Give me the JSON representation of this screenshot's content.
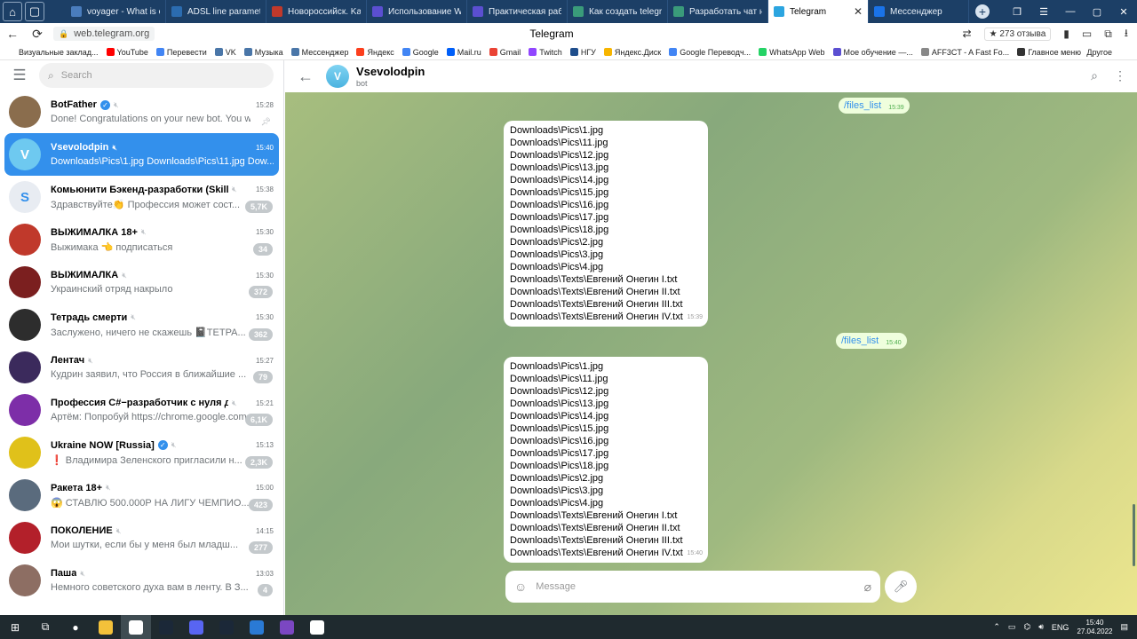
{
  "browser": {
    "tabs": [
      {
        "label": "voyager - What is co",
        "color": "#4a7dbd"
      },
      {
        "label": "ADSL line parameters",
        "color": "#2b6cb0"
      },
      {
        "label": "Новороссийск. Karat",
        "color": "#c0392b"
      },
      {
        "label": "Использование Web",
        "color": "#5b4fd1"
      },
      {
        "label": "Практическая работ",
        "color": "#5b4fd1"
      },
      {
        "label": "Как создать telegram",
        "color": "#3a9b7a"
      },
      {
        "label": "Разработать чат на C",
        "color": "#3a9b7a"
      },
      {
        "label": "Telegram",
        "color": "#2ca5e0",
        "active": true
      },
      {
        "label": "Мессенджер",
        "color": "#1a73e8"
      }
    ],
    "url": "web.telegram.org",
    "page_title": "Telegram",
    "rating_text": "★ 273 отзыва",
    "bookmarks": [
      {
        "label": "Визуальные заклад...",
        "color": "#ffffff"
      },
      {
        "label": "YouTube",
        "color": "#ff0000"
      },
      {
        "label": "Перевести",
        "color": "#4285f4"
      },
      {
        "label": "VK",
        "color": "#4a76a8"
      },
      {
        "label": "Музыка",
        "color": "#4a76a8"
      },
      {
        "label": "Мессенджер",
        "color": "#4a76a8"
      },
      {
        "label": "Яндекс",
        "color": "#fc3f1d"
      },
      {
        "label": "Google",
        "color": "#4285f4"
      },
      {
        "label": "Mail.ru",
        "color": "#005ff9"
      },
      {
        "label": "Gmail",
        "color": "#ea4335"
      },
      {
        "label": "Twitch",
        "color": "#9146ff"
      },
      {
        "label": "НГУ",
        "color": "#1f4e8c"
      },
      {
        "label": "Яндекс.Диск",
        "color": "#f7b500"
      },
      {
        "label": "Google Переводч...",
        "color": "#4285f4"
      },
      {
        "label": "WhatsApp Web",
        "color": "#25d366"
      },
      {
        "label": "Мое обучение —...",
        "color": "#5b4fd1"
      },
      {
        "label": "AFF3CT - A Fast Fo...",
        "color": "#888888"
      },
      {
        "label": "Главное меню",
        "color": "#333333"
      }
    ],
    "other_bookmarks": "Другое"
  },
  "sidebar": {
    "search_placeholder": "Search",
    "chats": [
      {
        "name": "BotFather",
        "time": "15:28",
        "preview": "Done! Congratulations on your new bot. You will ...",
        "badge": "",
        "pinned": true,
        "verified": true,
        "muted": true,
        "avatar_color": "#8a6d4d",
        "avatar_text": ""
      },
      {
        "name": "Vsevolodpin",
        "time": "15:40",
        "preview": "Downloads\\Pics\\1.jpg Downloads\\Pics\\11.jpg Dow...",
        "badge": "",
        "active": true,
        "muted": true,
        "avatar_color": "#6ec9f0",
        "avatar_text": "V"
      },
      {
        "name": "Комьюнити Бэкенд-разработки (Skillb...",
        "time": "15:38",
        "preview": "Здравствуйте👏 Профессия может сост...",
        "badge": "5,7K",
        "muted": true,
        "avatar_color": "#e8ecf2",
        "avatar_text": "S"
      },
      {
        "name": "ВЫЖИМАЛКА 18+",
        "time": "15:30",
        "preview": "Выжимака 👈 подписаться",
        "badge": "34",
        "muted": true,
        "avatar_color": "#c0392b",
        "avatar_text": ""
      },
      {
        "name": "ВЫЖИМАЛКА",
        "time": "15:30",
        "preview": "Украинский отряд накрыло",
        "badge": "372",
        "muted": true,
        "avatar_color": "#7b1f1f",
        "avatar_text": ""
      },
      {
        "name": "Тетрадь смерти",
        "time": "15:30",
        "preview": "Заслужено, ничего не скажешь 📓ТЕТРА...",
        "badge": "362",
        "muted": true,
        "avatar_color": "#2d2d2d",
        "avatar_text": ""
      },
      {
        "name": "Лентач",
        "time": "15:27",
        "preview": "Кудрин заявил, что Россия в ближайшие ...",
        "badge": "79",
        "muted": true,
        "avatar_color": "#3b2a5c",
        "avatar_text": ""
      },
      {
        "name": "Профессия C#−разработчик с нуля до ...",
        "time": "15:21",
        "preview": "Артём: Попробуй https://chrome.google.com...",
        "badge": "6,1K",
        "muted": true,
        "avatar_color": "#7d2ea8",
        "avatar_text": ""
      },
      {
        "name": "Ukraine NOW [Russia]",
        "time": "15:13",
        "preview": "❗ Владимира Зеленского пригласили н...",
        "badge": "2,3K",
        "verified": true,
        "muted": true,
        "avatar_color": "#e0c11a",
        "avatar_text": ""
      },
      {
        "name": "Ракета 18+",
        "time": "15:00",
        "preview": "😱 СТАВЛЮ 500.000Р НА ЛИГУ ЧЕМПИО...",
        "badge": "423",
        "muted": true,
        "avatar_color": "#5a6b7d",
        "avatar_text": ""
      },
      {
        "name": "ПОКОЛЕНИЕ",
        "time": "14:15",
        "preview": "Мои шутки, если бы у меня был младш...",
        "badge": "277",
        "muted": true,
        "avatar_color": "#b3202a",
        "avatar_text": ""
      },
      {
        "name": "Паша",
        "time": "13:03",
        "preview": "Немного советского духа вам в ленту. В З...",
        "badge": "4",
        "muted": true,
        "avatar_color": "#8d6e63",
        "avatar_text": ""
      }
    ]
  },
  "chat": {
    "name": "Vsevolodpin",
    "status": "bot",
    "avatar_text": "V",
    "messages": [
      {
        "type": "out",
        "text": "/files_list",
        "time": "15:39"
      },
      {
        "type": "in",
        "time": "15:39",
        "lines": [
          "Downloads\\Pics\\1.jpg",
          "Downloads\\Pics\\11.jpg",
          "Downloads\\Pics\\12.jpg",
          "Downloads\\Pics\\13.jpg",
          "Downloads\\Pics\\14.jpg",
          "Downloads\\Pics\\15.jpg",
          "Downloads\\Pics\\16.jpg",
          "Downloads\\Pics\\17.jpg",
          "Downloads\\Pics\\18.jpg",
          "Downloads\\Pics\\2.jpg",
          "Downloads\\Pics\\3.jpg",
          "Downloads\\Pics\\4.jpg",
          "Downloads\\Texts\\Евгений Онегин I.txt",
          "Downloads\\Texts\\Евгений Онегин II.txt",
          "Downloads\\Texts\\Евгений Онегин III.txt",
          "Downloads\\Texts\\Евгений Онегин IV.txt"
        ]
      },
      {
        "type": "out",
        "text": "/files_list",
        "time": "15:40"
      },
      {
        "type": "in",
        "time": "15:40",
        "lines": [
          "Downloads\\Pics\\1.jpg",
          "Downloads\\Pics\\11.jpg",
          "Downloads\\Pics\\12.jpg",
          "Downloads\\Pics\\13.jpg",
          "Downloads\\Pics\\14.jpg",
          "Downloads\\Pics\\15.jpg",
          "Downloads\\Pics\\16.jpg",
          "Downloads\\Pics\\17.jpg",
          "Downloads\\Pics\\18.jpg",
          "Downloads\\Pics\\2.jpg",
          "Downloads\\Pics\\3.jpg",
          "Downloads\\Pics\\4.jpg",
          "Downloads\\Texts\\Евгений Онегин I.txt",
          "Downloads\\Texts\\Евгений Онегин II.txt",
          "Downloads\\Texts\\Евгений Онегин III.txt",
          "Downloads\\Texts\\Евгений Онегин IV.txt"
        ]
      }
    ],
    "composer_placeholder": "Message"
  },
  "taskbar": {
    "apps": [
      {
        "name": "file-explorer",
        "color": "#f3c13a"
      },
      {
        "name": "yandex-browser",
        "color": "#ffffff"
      },
      {
        "name": "steam",
        "color": "#1b2838"
      },
      {
        "name": "discord",
        "color": "#5865f2"
      },
      {
        "name": "steam-2",
        "color": "#1b2838"
      },
      {
        "name": "notepad",
        "color": "#2a7ad5"
      },
      {
        "name": "visual-studio",
        "color": "#7b47c2"
      },
      {
        "name": "task-view",
        "color": "#ffffff"
      }
    ],
    "language": "ENG",
    "time": "15:40",
    "date": "27.04.2022"
  }
}
